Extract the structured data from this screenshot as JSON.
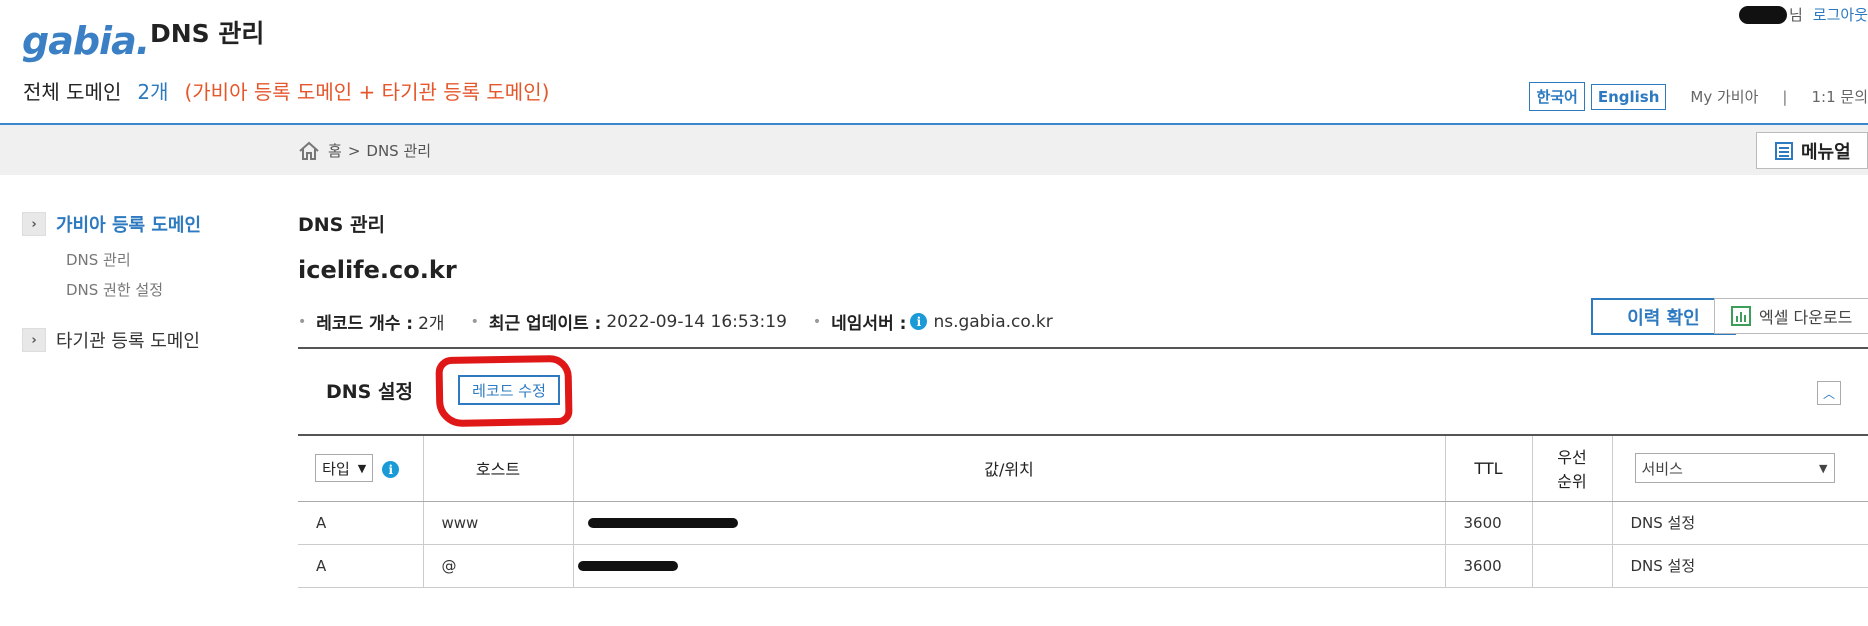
{
  "header": {
    "logo": "gabia.",
    "title": "DNS 관리",
    "user_suffix": "님",
    "logout": "로그아웃"
  },
  "summary": {
    "label": "전체 도메인",
    "count": "2개",
    "desc": "(가비아 등록 도메인 + 타기관 등록 도메인)"
  },
  "top_links": {
    "korean": "한국어",
    "english": "English",
    "my_gabia": "My 가비아",
    "separator": "|",
    "inquiry": "1:1 문의"
  },
  "breadcrumb": {
    "home": "홈",
    "sep": ">",
    "current": "DNS 관리"
  },
  "manual_label": "메뉴얼",
  "sidebar": {
    "group1": "가비아 등록 도메인",
    "group1_arrow": "›",
    "sub1": "DNS 관리",
    "sub2": "DNS 권한 설정",
    "group2": "타기관 등록 도메인",
    "group2_arrow": "›"
  },
  "main": {
    "section_title": "DNS 관리",
    "domain": "icelife.co.kr",
    "record_count_label": "레코드 개수 :",
    "record_count": "2개",
    "last_update_label": "최근 업데이트 :",
    "last_update": "2022-09-14 16:53:19",
    "nameserver_label": "네임서버 :",
    "nameserver": "ns.gabia.co.kr",
    "info_icon": "i",
    "history_button": "이력 확인",
    "excel_button": "엑셀 다운로드",
    "dns_setting": "DNS 설정",
    "record_edit": "레코드 수정",
    "collapse_icon": "︿"
  },
  "table": {
    "type_select": "타입",
    "host": "호스트",
    "value": "값/위치",
    "ttl": "TTL",
    "priority_1": "우선",
    "priority_2": "순위",
    "service_select": "서비스",
    "rows": [
      {
        "type": "A",
        "host": "www",
        "ttl": "3600",
        "priority": "",
        "service": "DNS 설정"
      },
      {
        "type": "A",
        "host": "@",
        "ttl": "3600",
        "priority": "",
        "service": "DNS 설정"
      }
    ]
  },
  "colors": {
    "accent": "#2d7ac0",
    "orange": "#e5562b",
    "red_mark": "#e01717"
  }
}
